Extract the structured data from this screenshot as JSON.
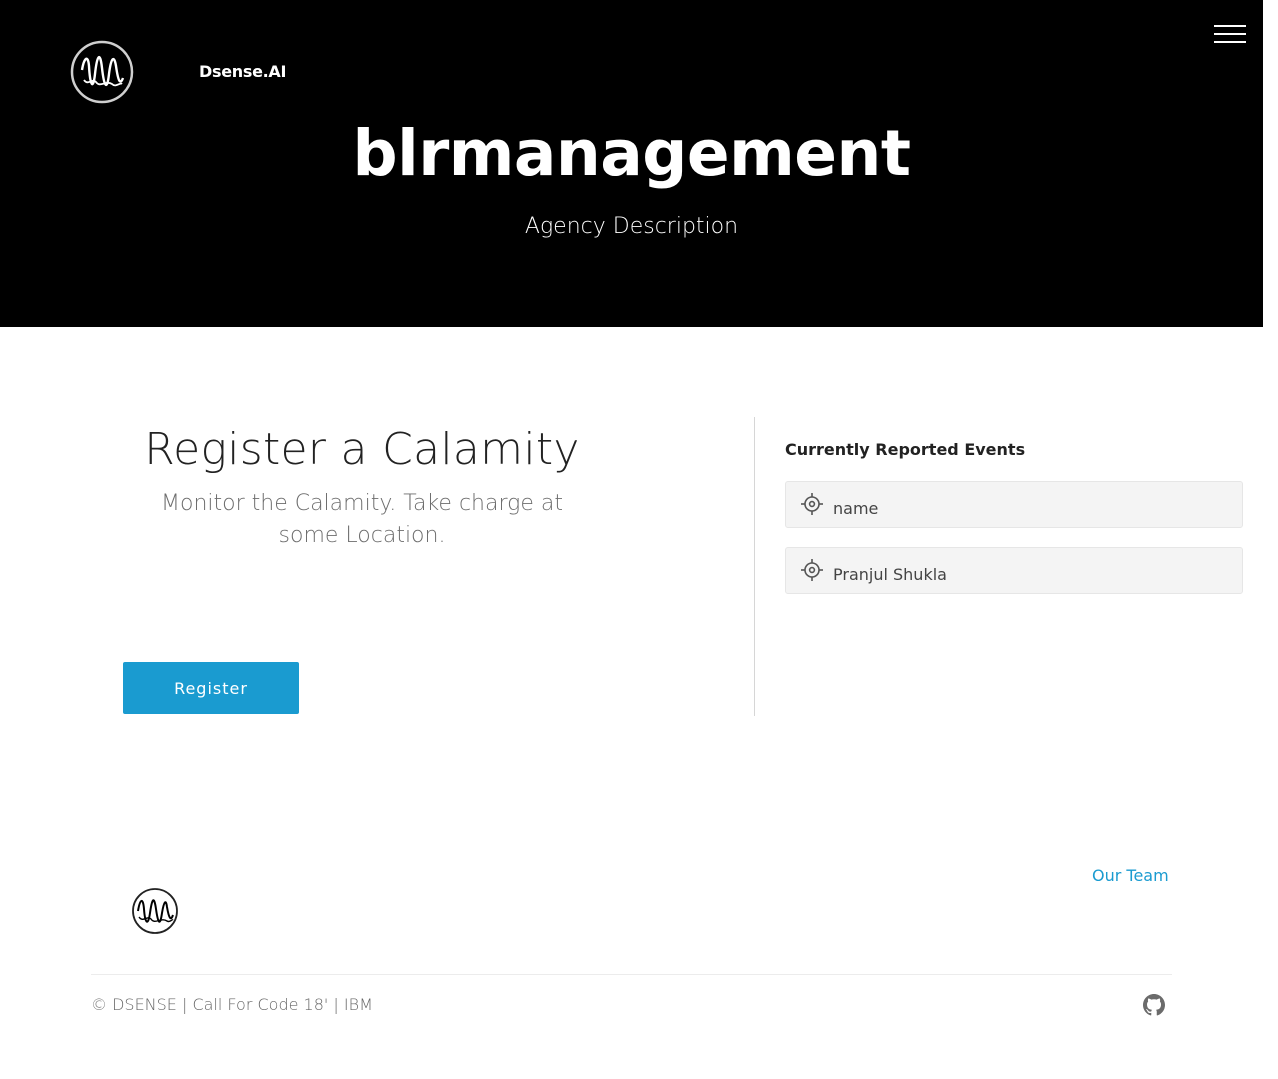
{
  "header": {
    "brand": "Dsense.AI",
    "logo_icon": "wave-circle-logo-icon",
    "menu_icon": "hamburger-menu-icon",
    "title": "blrmanagement",
    "subtitle": "Agency Description"
  },
  "main": {
    "title": "Register a Calamity",
    "subtitle": "Monitor the Calamity. Take charge at some Location.",
    "register_label": "Register",
    "accent_color": "#1a9bd0"
  },
  "events": {
    "title": "Currently Reported Events",
    "items": [
      {
        "icon": "location-target-icon",
        "name": "name"
      },
      {
        "icon": "location-target-icon",
        "name": "Pranjul Shukla"
      }
    ]
  },
  "footer": {
    "logo_icon": "wave-circle-logo-icon",
    "our_team_label": "Our Team",
    "copyright": "© DSENSE | Call For Code 18' | IBM",
    "github_icon": "github-icon"
  }
}
